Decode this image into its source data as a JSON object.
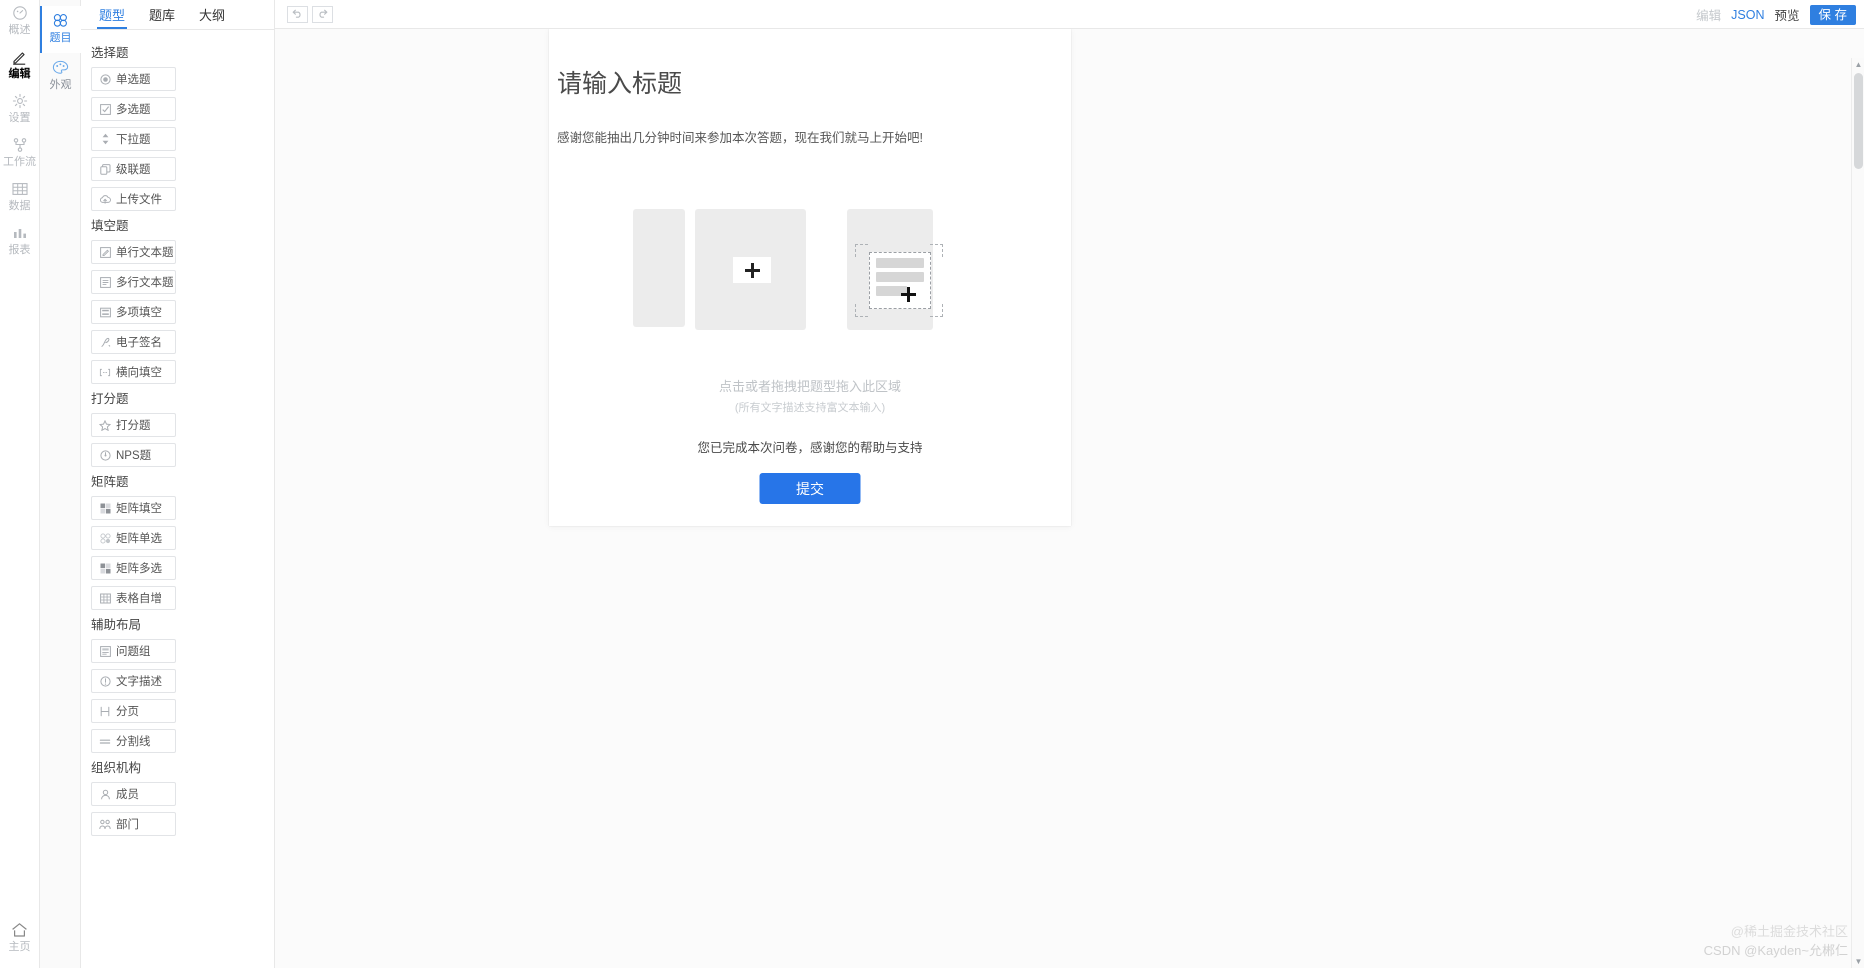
{
  "rail": {
    "items": [
      {
        "label": "概述",
        "icon": "gauge-icon",
        "active": false
      },
      {
        "label": "编辑",
        "icon": "pencil-icon",
        "active": true
      },
      {
        "label": "设置",
        "icon": "gear-icon",
        "active": false
      },
      {
        "label": "工作流",
        "icon": "workflow-icon",
        "active": false
      },
      {
        "label": "数据",
        "icon": "table-icon",
        "active": false
      },
      {
        "label": "报表",
        "icon": "bar-chart-icon",
        "active": false
      }
    ],
    "home": {
      "label": "主页",
      "icon": "home-icon"
    }
  },
  "vtabs": {
    "items": [
      {
        "label": "题目",
        "icon": "questions-icon",
        "active": true
      },
      {
        "label": "外观",
        "icon": "palette-icon",
        "active": false
      }
    ]
  },
  "palette": {
    "tabs": [
      {
        "label": "题型",
        "active": true
      },
      {
        "label": "题库",
        "active": false
      },
      {
        "label": "大纲",
        "active": false
      }
    ],
    "groups": [
      {
        "title": "选择题",
        "items": [
          {
            "label": "单选题",
            "icon": "radio-icon"
          },
          {
            "label": "多选题",
            "icon": "checkbox-icon"
          },
          {
            "label": "下拉题",
            "icon": "dropdown-icon"
          },
          {
            "label": "级联题",
            "icon": "cascade-icon"
          },
          {
            "label": "上传文件",
            "icon": "upload-cloud-icon"
          }
        ]
      },
      {
        "title": "填空题",
        "items": [
          {
            "label": "单行文本题",
            "icon": "edit-square-icon"
          },
          {
            "label": "多行文本题",
            "icon": "multiline-icon"
          },
          {
            "label": "多项填空",
            "icon": "multi-blank-icon"
          },
          {
            "label": "电子签名",
            "icon": "signature-pen-icon"
          },
          {
            "label": "横向填空",
            "icon": "inline-blank-icon"
          }
        ]
      },
      {
        "title": "打分题",
        "items": [
          {
            "label": "打分题",
            "icon": "star-icon"
          },
          {
            "label": "NPS题",
            "icon": "nps-dial-icon"
          }
        ]
      },
      {
        "title": "矩阵题",
        "items": [
          {
            "label": "矩阵填空",
            "icon": "matrix-blank-icon"
          },
          {
            "label": "矩阵单选",
            "icon": "matrix-radio-icon"
          },
          {
            "label": "矩阵多选",
            "icon": "matrix-checkbox-icon"
          },
          {
            "label": "表格自增",
            "icon": "grid-icon"
          }
        ]
      },
      {
        "title": "辅助布局",
        "items": [
          {
            "label": "问题组",
            "icon": "question-group-icon"
          },
          {
            "label": "文字描述",
            "icon": "info-circle-icon"
          },
          {
            "label": "分页",
            "icon": "page-break-icon"
          },
          {
            "label": "分割线",
            "icon": "divider-icon"
          }
        ]
      },
      {
        "title": "组织机构",
        "items": [
          {
            "label": "成员",
            "icon": "user-icon"
          },
          {
            "label": "部门",
            "icon": "org-icon"
          }
        ]
      }
    ]
  },
  "topbar": {
    "undo": {
      "icon": "undo-icon"
    },
    "redo": {
      "icon": "redo-icon"
    },
    "right": [
      {
        "label": "编辑",
        "style": "muted"
      },
      {
        "label": "JSON",
        "style": "accent"
      },
      {
        "label": "预览",
        "style": "plain"
      }
    ],
    "save_label": "保 存"
  },
  "survey": {
    "title": "请输入标题",
    "intro": "感谢您能抽出几分钟时间来参加本次答题，现在我们就马上开始吧!",
    "drop_hint": "点击或者拖拽把题型拖入此区域",
    "drop_sub": "(所有文字描述支持富文本输入)",
    "finish_text": "您已完成本次问卷，感谢您的帮助与支持",
    "submit_label": "提交"
  },
  "watermark": {
    "line1": "@稀土掘金技术社区",
    "line2": "CSDN @Kayden~允郴仁"
  },
  "colors": {
    "accent": "#2f7fe0",
    "submit": "#2775e8",
    "placeholder": "#ececec",
    "border": "#e8e8e8"
  }
}
